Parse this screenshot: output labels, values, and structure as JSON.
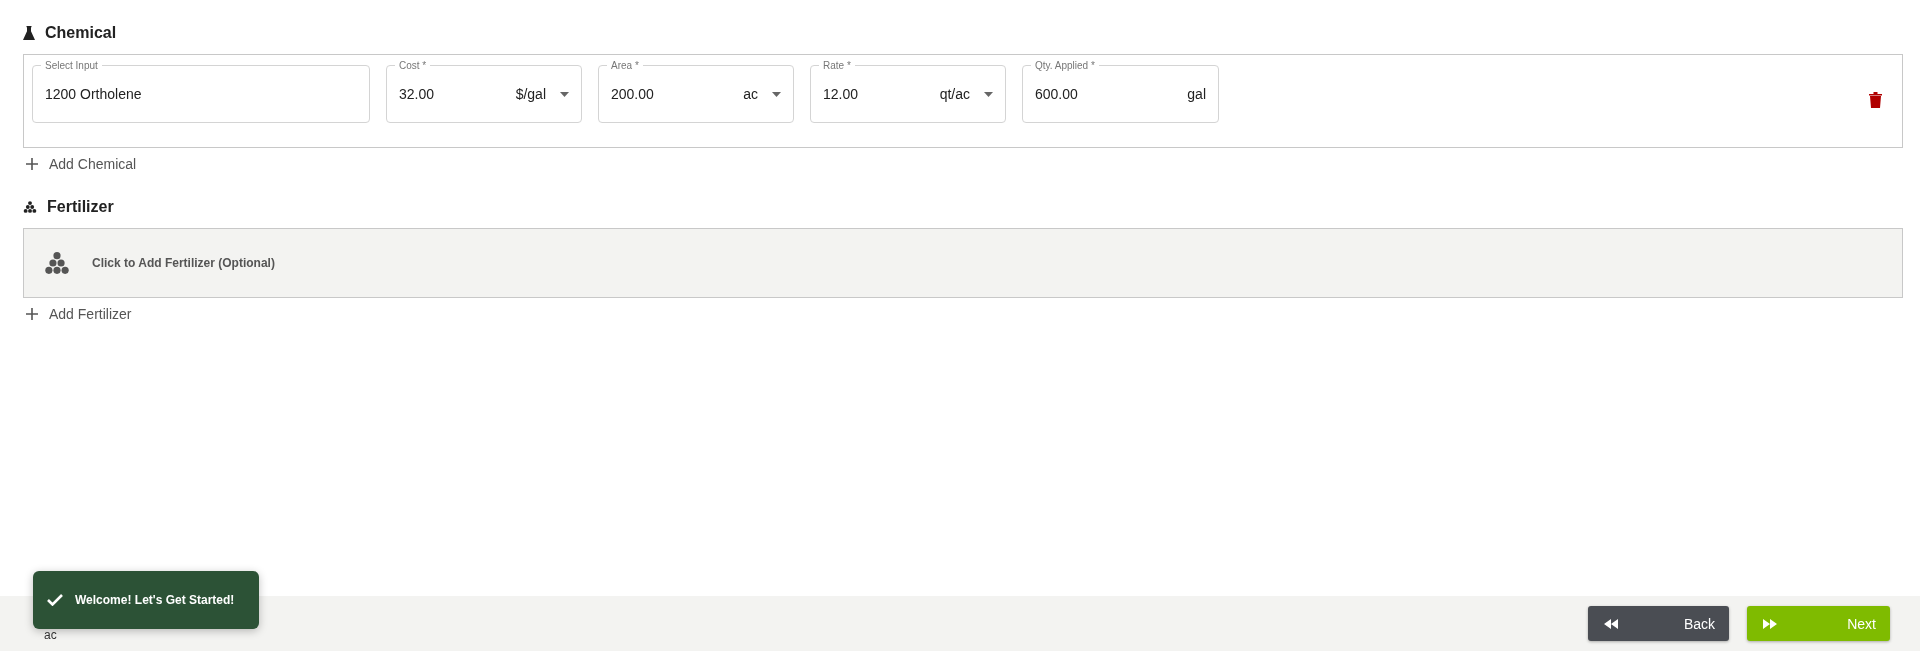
{
  "chemical": {
    "title": "Chemical",
    "rows": [
      {
        "fields": [
          {
            "kind": "text",
            "label": "Select Input",
            "value": "1200 Ortholene"
          },
          {
            "kind": "select",
            "label": "Cost *",
            "value": "32.00",
            "unit": "$/gal"
          },
          {
            "kind": "select",
            "label": "Area *",
            "value": "200.00",
            "unit": "ac"
          },
          {
            "kind": "select",
            "label": "Rate *",
            "value": "12.00",
            "unit": "qt/ac"
          },
          {
            "kind": "fixed",
            "label": "Qty. Applied *",
            "value": "600.00",
            "unit": "gal"
          }
        ]
      }
    ],
    "add_label": "Add Chemical"
  },
  "fertilizer": {
    "title": "Fertilizer",
    "empty_prompt": "Click to Add Fertilizer (Optional)",
    "add_label": "Add Fertilizer"
  },
  "footer": {
    "summary_unit": "ac",
    "buttons": [
      {
        "kind": "back",
        "label": "Back"
      },
      {
        "kind": "next",
        "label": "Next"
      }
    ]
  },
  "toast": {
    "message": "Welcome! Let's Get Started!"
  }
}
